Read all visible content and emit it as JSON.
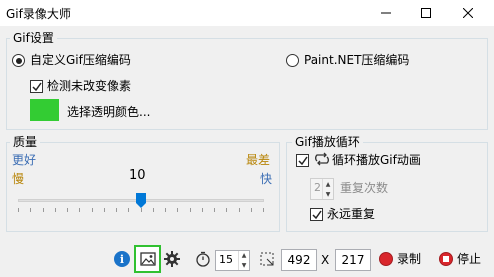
{
  "window": {
    "title": "Gif录像大师"
  },
  "gif_settings": {
    "group_title": "Gif设置",
    "custom_encoder_label": "自定义Gif压缩编码",
    "paintnet_encoder_label": "Paint.NET压缩编码",
    "detect_unchanged_label": "检测未改变像素",
    "transparent_color_label": "选择透明颜色...",
    "transparent_color": "#33cc33"
  },
  "quality": {
    "group_title": "质量",
    "better_label": "更好",
    "worst_label": "最差",
    "slow_label": "慢",
    "fast_label": "快",
    "value": "10",
    "slider_fraction": 0.5
  },
  "loop": {
    "group_title": "Gif播放循环",
    "loop_label": "循环播放Gif动画",
    "repeat_value": "2",
    "repeat_label": "重复次数",
    "forever_label": "永远重复"
  },
  "toolbar": {
    "fps_value": "15",
    "width_value": "492",
    "x_label": "X",
    "height_value": "217",
    "record_label": "录制",
    "stop_label": "停止"
  }
}
